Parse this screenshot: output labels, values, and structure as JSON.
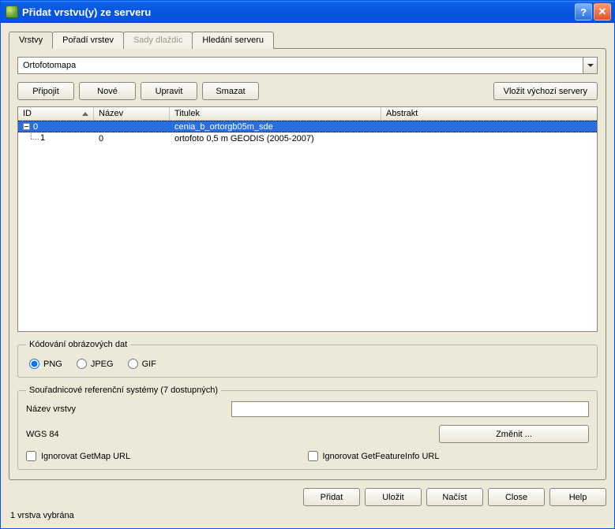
{
  "window": {
    "title": "Přidat vrstvu(y) ze serveru"
  },
  "tabs": {
    "layers": "Vrstvy",
    "order": "Pořadí vrstev",
    "tilesets": "Sady dlaždic",
    "search": "Hledání serveru"
  },
  "combo": {
    "value": "Ortofotomapa"
  },
  "toolbar": {
    "connect": "Připojit",
    "new": "Nové",
    "edit": "Upravit",
    "delete": "Smazat",
    "defaults": "Vložit výchozí servery"
  },
  "columns": {
    "id": "ID",
    "name": "Název",
    "title": "Titulek",
    "abstract": "Abstrakt"
  },
  "rows": [
    {
      "id": "0",
      "name": "",
      "title": "cenia_b_ortorgb05m_sde",
      "abstract": "",
      "indent": 0,
      "selected": true
    },
    {
      "id": "1",
      "name": "0",
      "title": "ortofoto 0,5 m GEODIS (2005-2007)",
      "abstract": "",
      "indent": 1,
      "selected": false
    }
  ],
  "encoding": {
    "legend": "Kódování obrázových dat",
    "options": {
      "png": "PNG",
      "jpeg": "JPEG",
      "gif": "GIF"
    },
    "selected": "png"
  },
  "crs": {
    "legend": "Souřadnicové referenční systémy  (7 dostupných)",
    "layer_name_label": "Název vrstvy",
    "layer_name_value": "",
    "crs_label": "WGS 84",
    "change": "Změnit ...",
    "ignore_getmap": "Ignorovat GetMap URL",
    "ignore_getfeature": "Ignorovat GetFeatureInfo URL"
  },
  "footer": {
    "add": "Přidat",
    "save": "Uložit",
    "load": "Načíst",
    "close": "Close",
    "help": "Help"
  },
  "status": "1 vrstva vybrána"
}
